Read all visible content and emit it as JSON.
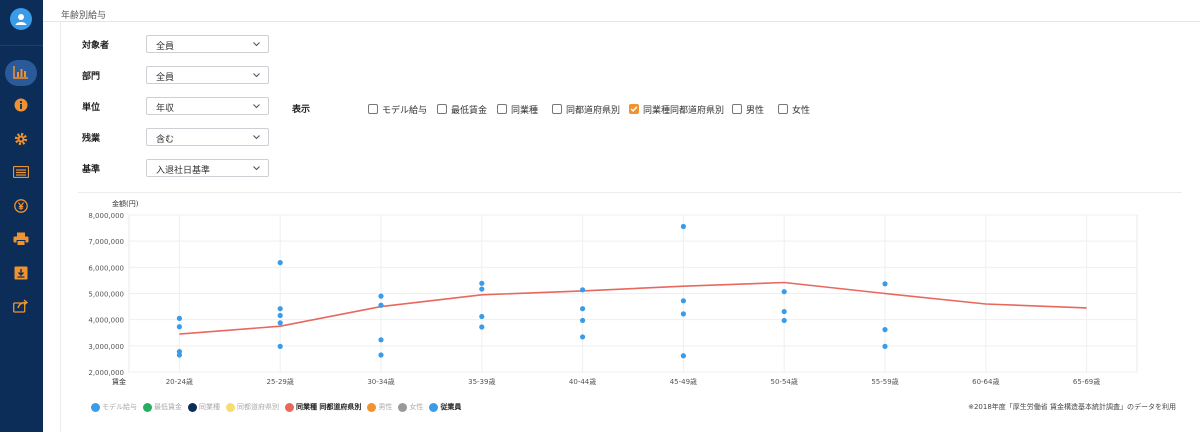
{
  "page": {
    "title": "年齢別給与"
  },
  "colors": {
    "sidebar": "#0c2d57",
    "accent_blue": "#3a9be8",
    "line_red": "#e8685e",
    "checkbox_orange": "#f0922f"
  },
  "sidebar": {
    "items": [
      {
        "icon": "bar-chart-icon",
        "active": true
      },
      {
        "icon": "info-icon",
        "active": false
      },
      {
        "icon": "gear-icon",
        "active": false
      },
      {
        "icon": "list-icon",
        "active": false
      },
      {
        "icon": "yen-icon",
        "active": false
      },
      {
        "icon": "printer-icon",
        "active": false
      },
      {
        "icon": "download-icon",
        "active": false
      },
      {
        "icon": "share-icon",
        "active": false
      }
    ]
  },
  "filters": [
    {
      "label": "対象者",
      "value": "全員"
    },
    {
      "label": "部門",
      "value": "全員"
    },
    {
      "label": "単位",
      "value": "年収"
    },
    {
      "label": "残業",
      "value": "含む"
    },
    {
      "label": "基準",
      "value": "入退社日基準"
    }
  ],
  "display": {
    "label": "表示",
    "options": [
      {
        "label": "モデル給与",
        "checked": false
      },
      {
        "label": "最低賃金",
        "checked": false
      },
      {
        "label": "同業種",
        "checked": false
      },
      {
        "label": "同都道府県別",
        "checked": false
      },
      {
        "label": "同業種同都道府県別",
        "checked": true
      },
      {
        "label": "男性",
        "checked": false
      },
      {
        "label": "女性",
        "checked": false
      }
    ]
  },
  "legend": [
    {
      "label": "モデル給与",
      "color": "#3a9be8",
      "active": false
    },
    {
      "label": "最低賃金",
      "color": "#27ae60",
      "active": false
    },
    {
      "label": "同業種",
      "color": "#0c2d57",
      "active": false
    },
    {
      "label": "同都道府県別",
      "color": "#f7dc6f",
      "active": false
    },
    {
      "label": "同業種 同都道府県別",
      "color": "#e8685e",
      "active": true
    },
    {
      "label": "男性",
      "color": "#f0922f",
      "active": false
    },
    {
      "label": "女性",
      "color": "#999999",
      "active": false
    },
    {
      "label": "従業員",
      "color": "#3a9be8",
      "active": true
    }
  ],
  "note": "※2018年度「厚生労働省 賃金構造基本統計調査」のデータを利用",
  "chart_data": {
    "type": "scatter",
    "ylabel": "金額(円)",
    "xlabel": "賃金",
    "ylim": [
      2000000,
      8000000
    ],
    "yticks": [
      2000000,
      3000000,
      4000000,
      5000000,
      6000000,
      7000000,
      8000000
    ],
    "ytick_labels": [
      "2,000,000",
      "3,000,000",
      "4,000,000",
      "5,000,000",
      "6,000,000",
      "7,000,000",
      "8,000,000"
    ],
    "categories": [
      "20-24歳",
      "25-29歳",
      "30-34歳",
      "35-39歳",
      "40-44歳",
      "45-49歳",
      "50-54歳",
      "55-59歳",
      "60-64歳",
      "65-69歳"
    ],
    "grid": true,
    "series": [
      {
        "name": "同業種 同都道府県別",
        "kind": "line",
        "color": "#e8685e",
        "values": [
          3450000,
          3750000,
          4500000,
          4950000,
          5100000,
          5280000,
          5420000,
          5000000,
          4600000,
          4450000
        ]
      },
      {
        "name": "従業員",
        "kind": "points",
        "color": "#3a9be8",
        "points": [
          [
            "20-24歳",
            4050000
          ],
          [
            "20-24歳",
            3730000
          ],
          [
            "20-24歳",
            2780000
          ],
          [
            "20-24歳",
            2650000
          ],
          [
            "25-29歳",
            6180000
          ],
          [
            "25-29歳",
            4420000
          ],
          [
            "25-29歳",
            4160000
          ],
          [
            "25-29歳",
            3880000
          ],
          [
            "25-29歳",
            2980000
          ],
          [
            "30-34歳",
            4900000
          ],
          [
            "30-34歳",
            4550000
          ],
          [
            "30-34歳",
            3230000
          ],
          [
            "30-34歳",
            2650000
          ],
          [
            "35-39歳",
            5390000
          ],
          [
            "35-39歳",
            5170000
          ],
          [
            "35-39歳",
            4120000
          ],
          [
            "35-39歳",
            3720000
          ],
          [
            "40-44歳",
            5140000
          ],
          [
            "40-44歳",
            4420000
          ],
          [
            "40-44歳",
            3970000
          ],
          [
            "40-44歳",
            3340000
          ],
          [
            "45-49歳",
            7560000
          ],
          [
            "45-49歳",
            4720000
          ],
          [
            "45-49歳",
            4220000
          ],
          [
            "45-49歳",
            2620000
          ],
          [
            "50-54歳",
            5070000
          ],
          [
            "50-54歳",
            4310000
          ],
          [
            "50-54歳",
            3970000
          ],
          [
            "55-59歳",
            5370000
          ],
          [
            "55-59歳",
            3620000
          ],
          [
            "55-59歳",
            2980000
          ]
        ]
      }
    ]
  }
}
